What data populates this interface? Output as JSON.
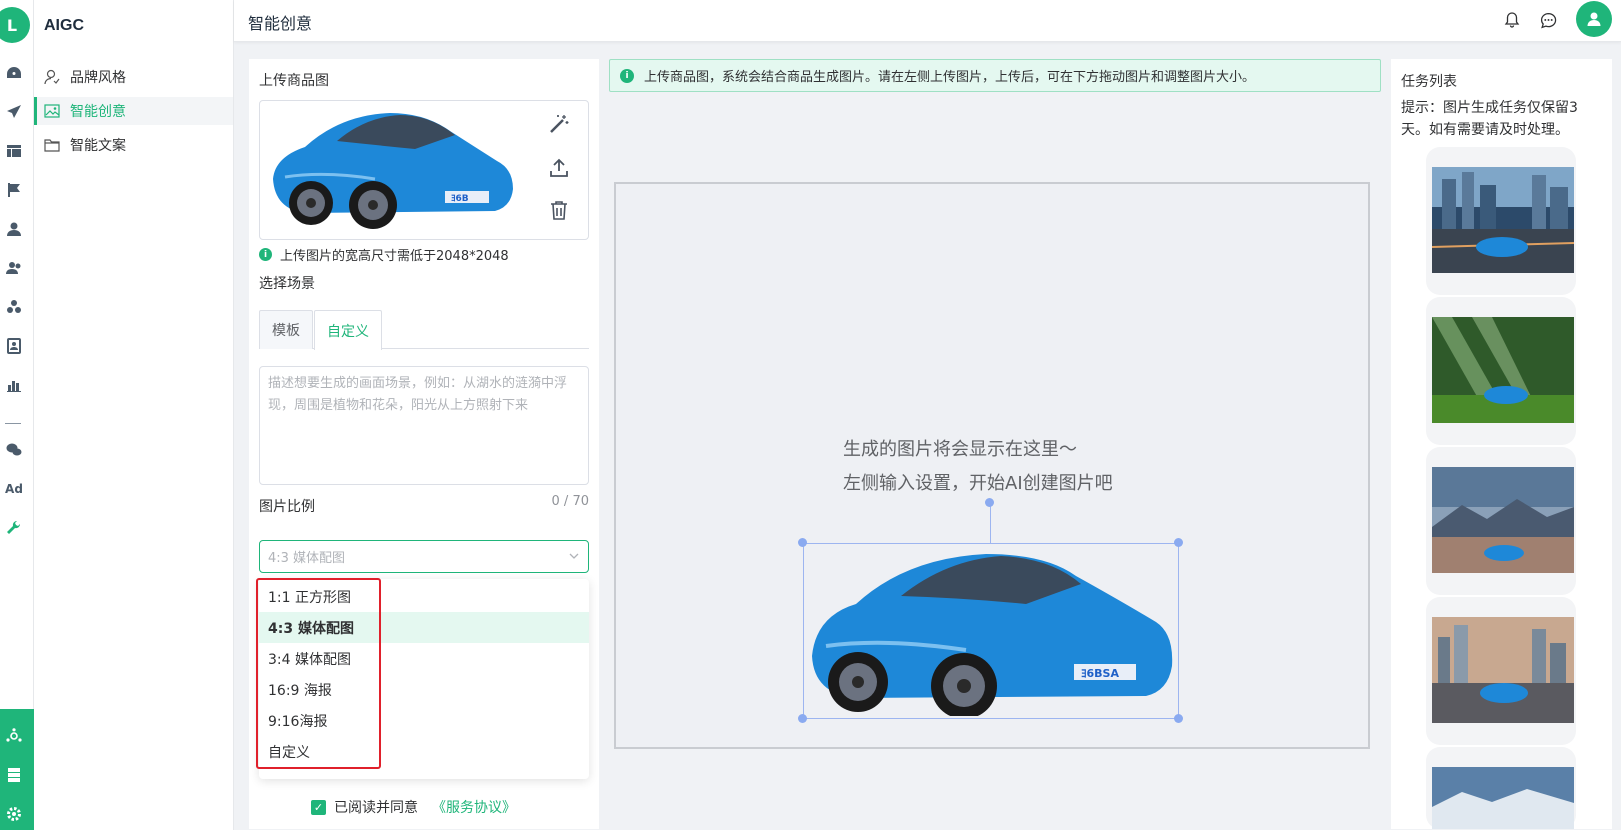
{
  "app": {
    "name": "AIGC"
  },
  "header": {
    "title": "智能创意"
  },
  "rail": {
    "icons": [
      "dashboard-icon",
      "send-icon",
      "layout-icon",
      "flag-icon",
      "user-icon",
      "users-icon",
      "group-icon",
      "contact-icon",
      "bar-chart-icon",
      "wechat-icon",
      "ad-icon",
      "wrench-icon",
      "hub-icon",
      "server-icon",
      "settings-icon"
    ],
    "ad_label": "Ad"
  },
  "menu": {
    "items": [
      {
        "label": "品牌风格",
        "icon": "user-outline-icon"
      },
      {
        "label": "智能创意",
        "icon": "image-icon"
      },
      {
        "label": "智能文案",
        "icon": "folder-icon"
      }
    ]
  },
  "left": {
    "upload_label": "上传商品图",
    "upload_tip": "上传图片的宽高尺寸需低于2048*2048",
    "scene_label": "选择场景",
    "tabs": [
      {
        "label": "模板"
      },
      {
        "label": "自定义"
      }
    ],
    "textarea_placeholder": "描述想要生成的画面场景，例如：从湖水的涟漪中浮现，周围是植物和花朵，阳光从上方照射下来",
    "counter": "0 / 70",
    "ratio_label": "图片比例",
    "ratio_selected": "4:3 媒体配图",
    "ratio_options": [
      {
        "label": "1:1 正方形图"
      },
      {
        "label": "4:3 媒体配图"
      },
      {
        "label": "3:4 媒体配图"
      },
      {
        "label": "16:9 海报"
      },
      {
        "label": "9:16海报"
      },
      {
        "label": "自定义"
      }
    ],
    "agree_text": "已阅读并同意",
    "agree_link": "《服务协议》"
  },
  "center": {
    "notice": "上传商品图，系统会结合商品生成图片。请在左侧上传图片，上传后，可在下方拖动图片和调整图片大小。",
    "placeholder_line1": "生成的图片将会显示在这里～",
    "placeholder_line2": "左侧输入设置，开始AI创建图片吧"
  },
  "right": {
    "title": "任务列表",
    "tip": "提示：图片生成任务仅保留3天。如有需要请及时处理。"
  },
  "colors": {
    "accent": "#1fb57a",
    "car": "#1e88d8",
    "highlight": "#e0202b"
  }
}
